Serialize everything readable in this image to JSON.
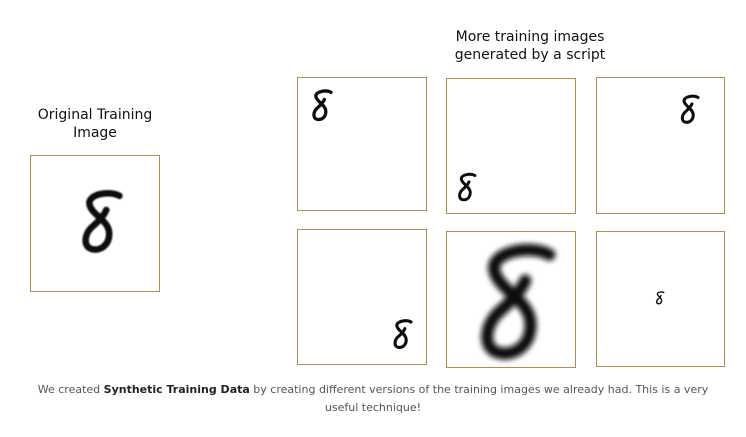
{
  "original": {
    "heading_line1": "Original Training",
    "heading_line2": "Image"
  },
  "generated": {
    "heading_line1": "More training images",
    "heading_line2": "generated by a script"
  },
  "caption": {
    "part1": "We created ",
    "bold": "Synthetic Training Data",
    "part2": " by creating different versions of the training images we already had. This is a very useful technique!"
  },
  "colors": {
    "frame": "#b18d48",
    "digit": "#0d0d0d"
  }
}
